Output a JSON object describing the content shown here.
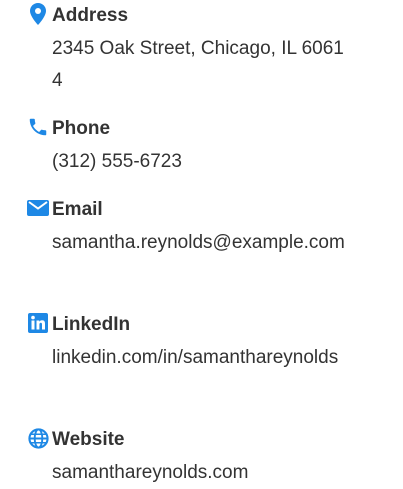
{
  "accent_color": "#1e88e5",
  "contacts": [
    {
      "icon": "map-pin-icon",
      "label": "Address",
      "value": "2345 Oak Street, Chicago, IL 60614"
    },
    {
      "icon": "phone-icon",
      "label": "Phone",
      "value": "(312) 555-6723"
    },
    {
      "icon": "envelope-icon",
      "label": "Email",
      "value": "samantha.reynolds@example.com"
    },
    {
      "icon": "linkedin-icon",
      "label": "LinkedIn",
      "value": "linkedin.com/in/samanthareynolds"
    },
    {
      "icon": "globe-icon",
      "label": "Website",
      "value": "samanthareynolds.com"
    }
  ]
}
